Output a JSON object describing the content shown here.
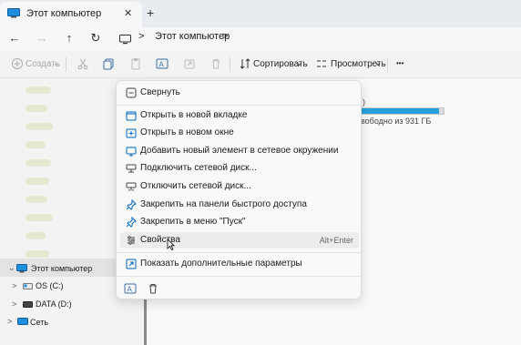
{
  "tabs": {
    "active_title": "Этот компьютер",
    "close_glyph": "✕",
    "new_glyph": "+"
  },
  "nav": {
    "back_glyph": "←",
    "forward_glyph": "→",
    "up_glyph": "↑",
    "refresh_glyph": "↻",
    "breadcrumb": "Этот компьютер",
    "sep_glyph": ">"
  },
  "toolbar": {
    "create_label": "Создать",
    "sort_label": "Сортировать",
    "view_label": "Просмотреть",
    "more_glyph": "•••",
    "dropdown_glyph": "⌄"
  },
  "drive": {
    "label_fragment": ")",
    "free_text": "вободно из 931 ГБ",
    "used_fraction": 0.94,
    "bar_color": "#26a0da"
  },
  "sidebar": {
    "this_pc": "Этот компьютер",
    "drives": [
      "OS (C:)",
      "DATA (D:)"
    ],
    "network": "Сеть",
    "chevron": ">"
  },
  "context_menu": {
    "items": [
      {
        "label": "Свернуть",
        "icon": "collapse-icon"
      },
      {
        "label": "Открыть в новой вкладке",
        "icon": "new-tab-icon"
      },
      {
        "label": "Открыть в новом окне",
        "icon": "new-window-icon"
      },
      {
        "label": "Добавить новый элемент в сетевое окружении",
        "icon": "add-network-location-icon"
      },
      {
        "label": "Подключить сетевой диск...",
        "icon": "map-network-drive-icon"
      },
      {
        "label": "Отключить сетевой диск...",
        "icon": "disconnect-network-drive-icon"
      },
      {
        "label": "Закрепить на панели быстрого доступа",
        "icon": "pin-icon"
      },
      {
        "label": "Закрепить в меню \"Пуск\"",
        "icon": "pin-start-icon"
      },
      {
        "label": "Свойства",
        "icon": "properties-icon",
        "shortcut": "Alt+Enter"
      },
      {
        "label": "Показать дополнительные параметры",
        "icon": "more-options-icon"
      }
    ]
  },
  "colors": {
    "accent": "#0067c0",
    "drive_bar": "#26a0da"
  }
}
